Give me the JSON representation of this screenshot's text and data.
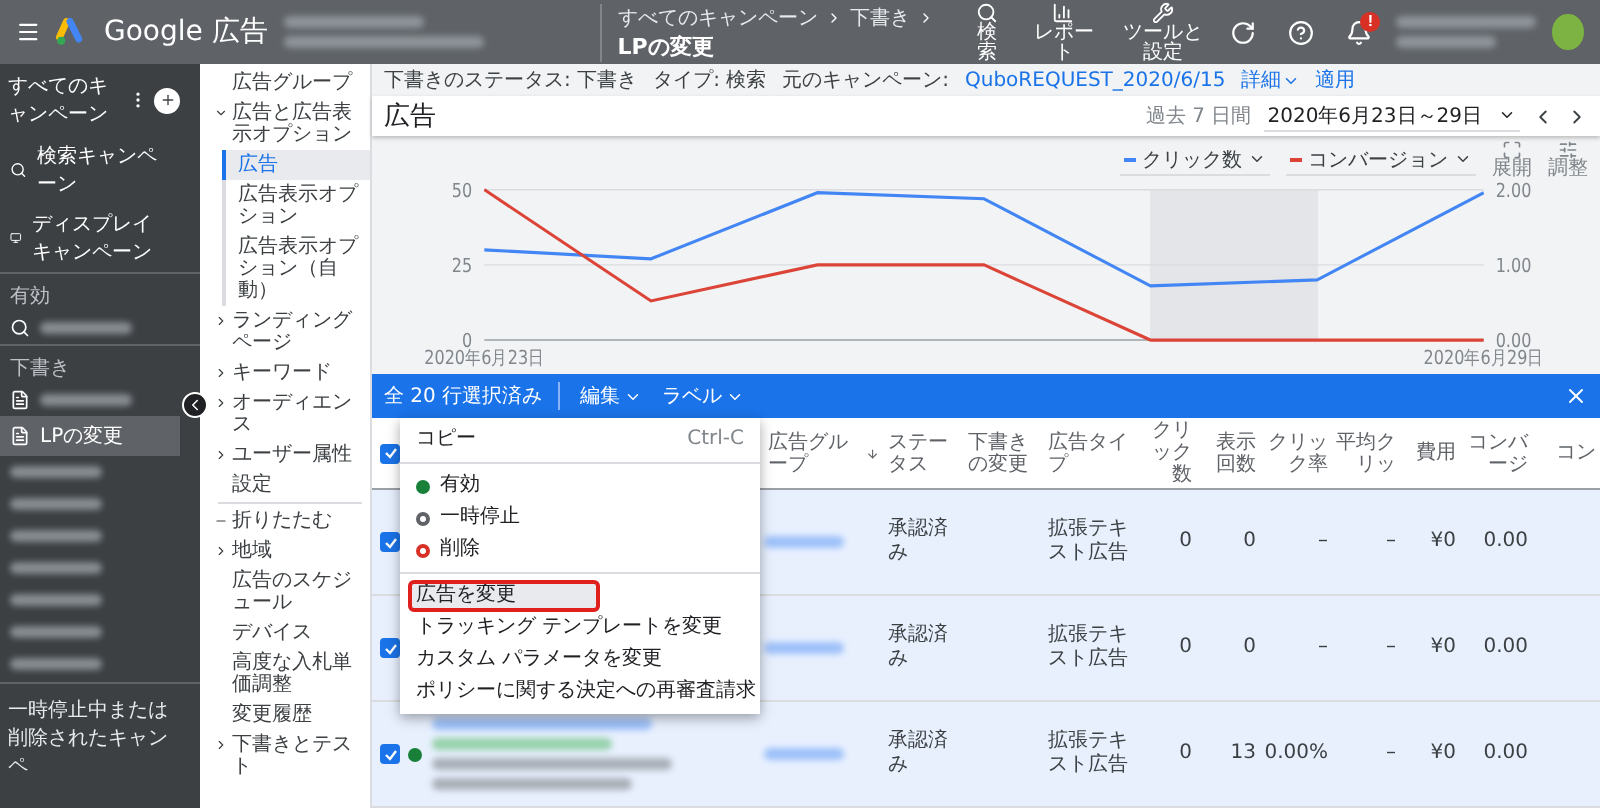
{
  "header": {
    "product": "Google 広告",
    "breadcrumbs": [
      "すべてのキャンペーン",
      "下書き"
    ],
    "page_title": "LPの変更",
    "tools": [
      {
        "kind": "search",
        "label": "検索"
      },
      {
        "kind": "report",
        "label": "レポート"
      },
      {
        "kind": "tools",
        "label": "ツールと設定"
      }
    ],
    "notification_badge": "!"
  },
  "sidebar": {
    "title": "すべてのキャンペーン",
    "items": [
      {
        "kind": "search",
        "label": "検索キャンペーン",
        "selected": false
      },
      {
        "kind": "display",
        "label": "ディスプレイキャンペーン",
        "selected": false
      },
      {
        "kind": "section",
        "label": "有効"
      },
      {
        "kind": "redacted-search",
        "selected": false
      },
      {
        "kind": "section",
        "label": "下書き"
      },
      {
        "kind": "redacted-doc",
        "selected": false
      },
      {
        "kind": "doc",
        "label": "LPの変更",
        "selected": true
      },
      {
        "kind": "redacted",
        "selected": false
      },
      {
        "kind": "redacted",
        "selected": false
      },
      {
        "kind": "redacted",
        "selected": false
      },
      {
        "kind": "redacted",
        "selected": false
      },
      {
        "kind": "redacted",
        "selected": false
      },
      {
        "kind": "redacted",
        "selected": false
      },
      {
        "kind": "redacted",
        "selected": false
      },
      {
        "kind": "footer",
        "label": "一時停止中または削除されたキャンペ"
      }
    ]
  },
  "nav": [
    {
      "kind": "plain",
      "label": "広告グループ",
      "selected": false
    },
    {
      "kind": "expandable",
      "label": "広告と広告表示オプション",
      "expanded": true,
      "selected": false,
      "children": [
        {
          "label": "広告",
          "selected": true
        },
        {
          "label": "広告表示オプション",
          "selected": false
        },
        {
          "label": "広告表示オプション（自動）",
          "selected": false
        }
      ]
    },
    {
      "kind": "expandable",
      "label": "ランディングページ",
      "expanded": false,
      "selected": false
    },
    {
      "kind": "expandable",
      "label": "キーワード",
      "expanded": false,
      "selected": false
    },
    {
      "kind": "expandable",
      "label": "オーディエンス",
      "expanded": false,
      "selected": false
    },
    {
      "kind": "expandable",
      "label": "ユーザー属性",
      "expanded": false,
      "selected": false
    },
    {
      "kind": "plain",
      "label": "設定",
      "selected": false
    },
    {
      "kind": "collapse",
      "label": "折りたたむ",
      "selected": false
    },
    {
      "kind": "expandable",
      "label": "地域",
      "expanded": false,
      "selected": false
    },
    {
      "kind": "plain",
      "label": "広告のスケジュール",
      "selected": false
    },
    {
      "kind": "plain",
      "label": "デバイス",
      "selected": false
    },
    {
      "kind": "plain",
      "label": "高度な入札単価調整",
      "selected": false
    },
    {
      "kind": "plain",
      "label": "変更履歴",
      "selected": false
    },
    {
      "kind": "expandable",
      "label": "下書きとテスト",
      "expanded": false,
      "selected": false
    }
  ],
  "draft_bar": {
    "status_label": "下書きのステータス:",
    "status": "下書き",
    "type_label": "タイプ:",
    "type": "検索",
    "source_label": "元のキャンペーン:",
    "source": "QuboREQUEST_2020/6/15",
    "details": "詳細",
    "apply": "適用"
  },
  "page": {
    "title": "広告",
    "range_label": "過去 7 日間",
    "range": "2020年6月23日～29日"
  },
  "chart": {
    "hover_band": true,
    "expand_label": "展開",
    "adjust_label": "調整",
    "right_ticks": [
      "2.00",
      "1.00",
      "0.00"
    ],
    "chart_data": {
      "type": "line",
      "categories": [
        "2020年6月23日",
        null,
        null,
        null,
        null,
        null,
        "2020年6月29日"
      ],
      "ylim": [
        0,
        50
      ],
      "yticks": [
        0,
        25,
        50
      ],
      "series": [
        {
          "name": "クリック数",
          "color": "#4285f4",
          "values": [
            30,
            27,
            49,
            47,
            18,
            20,
            49
          ]
        },
        {
          "name": "コンバージョン",
          "color": "#db4437",
          "values": [
            50,
            13,
            25,
            25,
            0,
            0,
            0
          ]
        }
      ]
    }
  },
  "selection_bar": {
    "count": "全 20 行選択済み",
    "edit": "編集",
    "label": "ラベル"
  },
  "table": {
    "all_checked": true,
    "columns": [
      "広告グループ",
      "ステータス",
      "下書きの変更",
      "広告タイプ",
      "クリック数",
      "表示回数",
      "クリック率",
      "平均クリッ",
      "費用",
      "コンバージ",
      "コン"
    ],
    "rows": [
      {
        "checked": true,
        "cells": [
          "",
          "承認済み",
          "",
          "拡張テキスト広告",
          "0",
          "0",
          "–",
          "–",
          "¥0",
          "0.00"
        ]
      },
      {
        "checked": true,
        "cells": [
          "",
          "承認済み",
          "",
          "拡張テキスト広告",
          "0",
          "0",
          "–",
          "–",
          "¥0",
          "0.00"
        ]
      },
      {
        "checked": true,
        "color": "#188038",
        "cells": [
          "",
          "承認済み",
          "",
          "拡張テキスト広告",
          "0",
          "13",
          "0.00%",
          "–",
          "¥0",
          "0.00"
        ]
      }
    ]
  },
  "menu": {
    "items": [
      {
        "kind": "action",
        "label": "コピー",
        "shortcut": "Ctrl-C",
        "selected": false
      },
      {
        "kind": "divider"
      },
      {
        "kind": "status",
        "label": "有効",
        "color": "#188038",
        "filled": true,
        "selected": false
      },
      {
        "kind": "status",
        "label": "一時停止",
        "color": "#5f6368",
        "filled": false,
        "selected": false
      },
      {
        "kind": "status",
        "label": "削除",
        "color": "#d93025",
        "filled": false,
        "selected": false
      },
      {
        "kind": "divider"
      },
      {
        "kind": "action",
        "label": "広告を変更",
        "selected": true
      },
      {
        "kind": "action",
        "label": "トラッキング テンプレートを変更",
        "selected": false
      },
      {
        "kind": "action",
        "label": "カスタム パラメータを変更",
        "selected": false
      },
      {
        "kind": "action",
        "label": "ポリシーに関する決定への再審査請求",
        "selected": false
      }
    ]
  }
}
